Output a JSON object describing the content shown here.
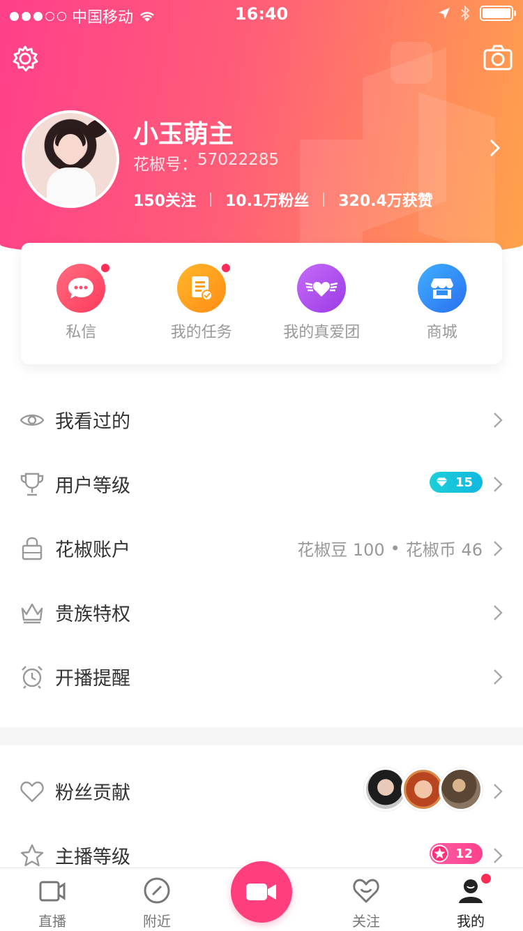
{
  "status_bar": {
    "carrier": "中国移动",
    "time": "16:40"
  },
  "profile": {
    "name": "小玉萌主",
    "id_label": "花椒号：",
    "id_value": "57022285",
    "stats": [
      {
        "value": "150",
        "label": "关注"
      },
      {
        "value": "10.1万",
        "label": "粉丝"
      },
      {
        "value": "320.4万",
        "label": "获赞"
      }
    ]
  },
  "quick_actions": [
    {
      "label": "私信",
      "icon": "chat-bubble-icon",
      "color": "#ff4d6d",
      "badge": true
    },
    {
      "label": "我的任务",
      "icon": "task-document-icon",
      "color": "#ff9f1a",
      "badge": true
    },
    {
      "label": "我的真爱团",
      "icon": "winged-heart-icon",
      "color": "#b34cf0",
      "badge": false
    },
    {
      "label": "商城",
      "icon": "store-icon",
      "color": "#2f8ff5",
      "badge": false
    }
  ],
  "menu": [
    {
      "label": "我看过的",
      "icon": "eye-icon"
    },
    {
      "label": "用户等级",
      "icon": "trophy-icon",
      "level": "15"
    },
    {
      "label": "花椒账户",
      "icon": "bag-icon",
      "beans": "花椒豆 100",
      "bullet": "•",
      "coins": "花椒币 46"
    },
    {
      "label": "贵族特权",
      "icon": "crown-icon"
    },
    {
      "label": "开播提醒",
      "icon": "alarm-clock-icon"
    }
  ],
  "menu2": [
    {
      "label": "粉丝贡献",
      "icon": "heart-outline-icon"
    },
    {
      "label": "主播等级",
      "icon": "star-outline-icon",
      "level": "12"
    }
  ],
  "tabbar": [
    {
      "label": "直播",
      "icon": "live-video-icon"
    },
    {
      "label": "附近",
      "icon": "compass-icon"
    },
    {
      "label": "",
      "icon": "camera-record-icon"
    },
    {
      "label": "关注",
      "icon": "heart-smile-icon"
    },
    {
      "label": "我的",
      "icon": "profile-person-icon",
      "active": true
    }
  ],
  "colors": {
    "accent": "#ff3f7c",
    "level_teal": "#1ccfd8",
    "level_pink": "#ff3f8a"
  }
}
